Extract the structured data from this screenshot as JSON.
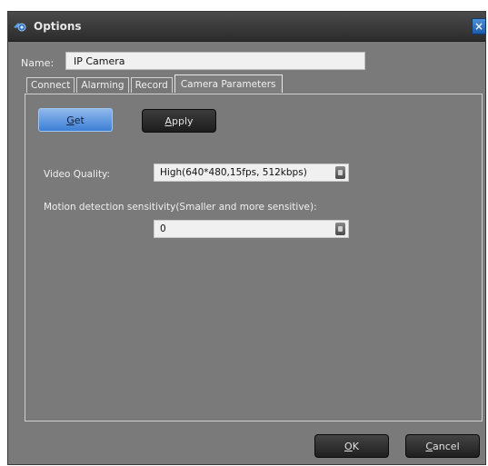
{
  "window": {
    "title": "Options",
    "close_glyph": "×",
    "accent": "#2f6fc0"
  },
  "name": {
    "label": "Name:",
    "value": "IP Camera"
  },
  "tabs": [
    {
      "label": "Connect",
      "active": false
    },
    {
      "label": "Alarming",
      "active": false
    },
    {
      "label": "Record",
      "active": false
    },
    {
      "label": "Camera Parameters",
      "active": true
    }
  ],
  "buttons": {
    "get": {
      "first": "G",
      "rest": "et"
    },
    "apply": {
      "first": "A",
      "rest": "pply"
    },
    "ok": {
      "first": "O",
      "rest": "K"
    },
    "cancel": {
      "first": "C",
      "rest": "ancel"
    }
  },
  "video_quality": {
    "label": "Video Quality:",
    "selected": "High(640*480,15fps, 512kbps)"
  },
  "motion": {
    "label": "Motion detection sensitivity(Smaller and more sensitive):",
    "selected": "0"
  },
  "icons": {
    "app": "camera-app-icon",
    "dropdown": "dropdown-arrow-icon"
  }
}
